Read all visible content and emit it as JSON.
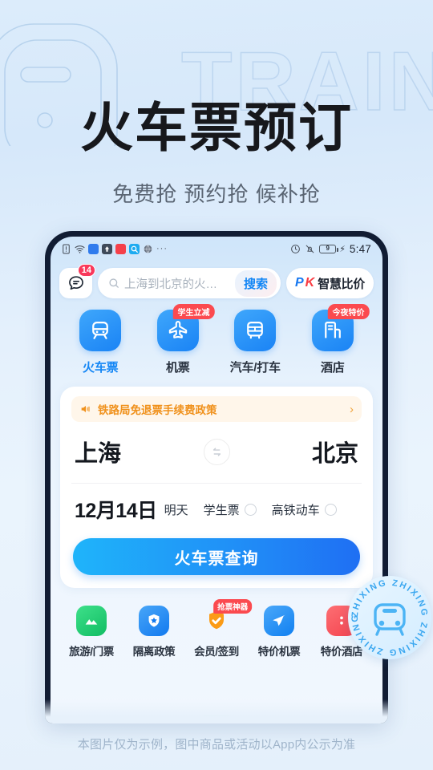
{
  "hero": {
    "title": "火车票预订",
    "subtitle": "免费抢 预约抢 候补抢",
    "watermark": "TRAIN"
  },
  "statusbar": {
    "icons": [
      "sim-alert-icon",
      "wifi-icon",
      "app-green-icon",
      "upload-arrow-icon",
      "app-red-icon",
      "search-app-icon",
      "globe-icon"
    ],
    "overflow": "···",
    "alarm": "alarm-icon",
    "bell": "bell-muted-icon",
    "battery_level": "9",
    "charging": "⚡",
    "time": "5:47"
  },
  "search": {
    "chat_icon": "chat-icon",
    "chat_badge": "14",
    "magnifier": "search-icon",
    "placeholder": "上海到北京的火…",
    "go_label": "搜索",
    "pk_p": "P",
    "pk_k": "K",
    "pk_label": "智慧比价"
  },
  "categories": [
    {
      "label": "火车票",
      "icon": "train-icon",
      "active": true,
      "badge": ""
    },
    {
      "label": "机票",
      "icon": "plane-icon",
      "active": false,
      "badge": "学生立减"
    },
    {
      "label": "汽车/打车",
      "icon": "bus-icon",
      "active": false,
      "badge": ""
    },
    {
      "label": "酒店",
      "icon": "hotel-icon",
      "active": false,
      "badge": "今夜特价"
    }
  ],
  "card": {
    "notice": {
      "icon": "speaker-icon",
      "text": "铁路局免退票手续费政策",
      "arrow": "›"
    },
    "from_city": "上海",
    "to_city": "北京",
    "swap_icon": "swap-icon",
    "date": "12月14日",
    "date_relative": "明天",
    "options": [
      {
        "label": "学生票",
        "checked": false
      },
      {
        "label": "高铁动车",
        "checked": false
      }
    ],
    "query_button": "火车票查询"
  },
  "bottom_items": [
    {
      "label": "旅游/门票",
      "icon": "mountain-icon",
      "color": "#18c26b",
      "badge": ""
    },
    {
      "label": "隔离政策",
      "icon": "shield-star-icon",
      "color": "#1b87f3",
      "badge": ""
    },
    {
      "label": "会员/签到",
      "icon": "shield-check-icon",
      "color": "#fa9719",
      "badge": "抢票神器"
    },
    {
      "label": "特价机票",
      "icon": "paper-plane-icon",
      "color": "#1b87f3",
      "badge": ""
    },
    {
      "label": "特价酒店",
      "icon": "door-icon",
      "color": "#f8555d",
      "badge": ""
    }
  ],
  "seal": {
    "text": "ZHIXING",
    "icon": "bus-seal-icon"
  },
  "footer": {
    "disclaimer": "本图片仅为示例，图中商品或活动以App内公示为准"
  },
  "colors": {
    "brand_blue": "#1386f5",
    "accent_red": "#fb4a4f",
    "notice_orange": "#f0911c",
    "page_bg": "#e4f0fb"
  }
}
